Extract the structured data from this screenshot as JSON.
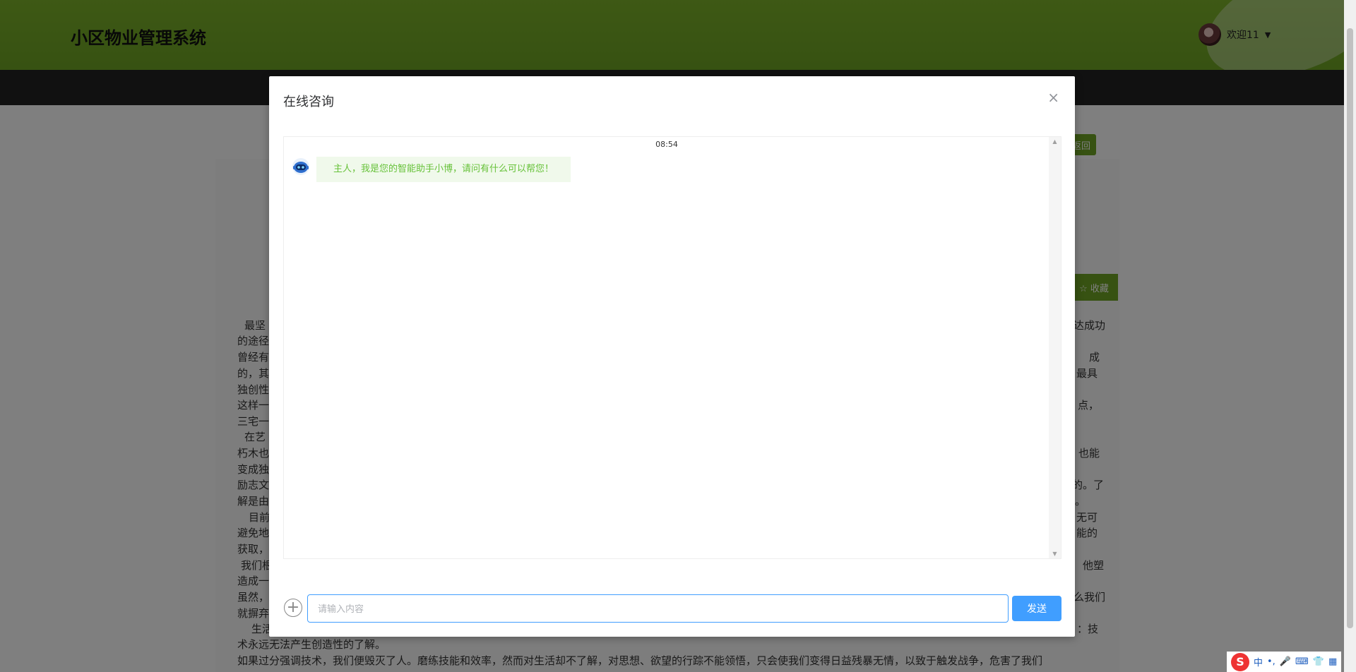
{
  "header": {
    "site_title": "小区物业管理系统",
    "welcome": "欢迎11",
    "caret": "▼"
  },
  "background": {
    "back_button": "返回",
    "favorite_button": "☆ 收藏",
    "text_left": [
      "最坚",
      "的途径",
      "曾经有",
      "的，其",
      "独创性",
      "这样一",
      "三宅一",
      "在艺",
      "朽木也",
      "变成独",
      "励志文",
      "解是由",
      "目前",
      "避免地",
      "获取，",
      "我们根",
      "造成一",
      "虽然，",
      "就摒弃",
      "生活"
    ],
    "text_right": [
      "达成功",
      "成",
      "最具",
      "点，",
      "也能",
      "的。了",
      "。",
      "无可",
      "能的",
      "他塑",
      "么我们",
      "：技"
    ],
    "bottom_lines": [
      "术永远无法产生创造性的了解。",
      "如果过分强调技术，我们便毁灭了人。磨练技能和效率，然而对生活却不了解，对思想、欲望的行踪不能领悟，只会使我们变得日益残暴无情，以致于触发战争，危害了我们"
    ]
  },
  "modal": {
    "title": "在线咨询",
    "close": "×",
    "chat": {
      "time": "08:54",
      "messages": [
        {
          "sender": "bot",
          "text": "主人，我是您的智能助手小博，请问有什么可以帮您！"
        }
      ]
    },
    "input": {
      "placeholder": "请输入内容",
      "value": ""
    },
    "plus": "+",
    "send_label": "发送"
  },
  "ime": {
    "logo": "S",
    "lang": "中",
    "items": [
      "•,",
      "🎤",
      "⌨",
      "👕",
      "▦"
    ]
  },
  "colors": {
    "header_green": "#6ea424",
    "primary_blue": "#409eff",
    "bot_green": "#67c23a"
  }
}
